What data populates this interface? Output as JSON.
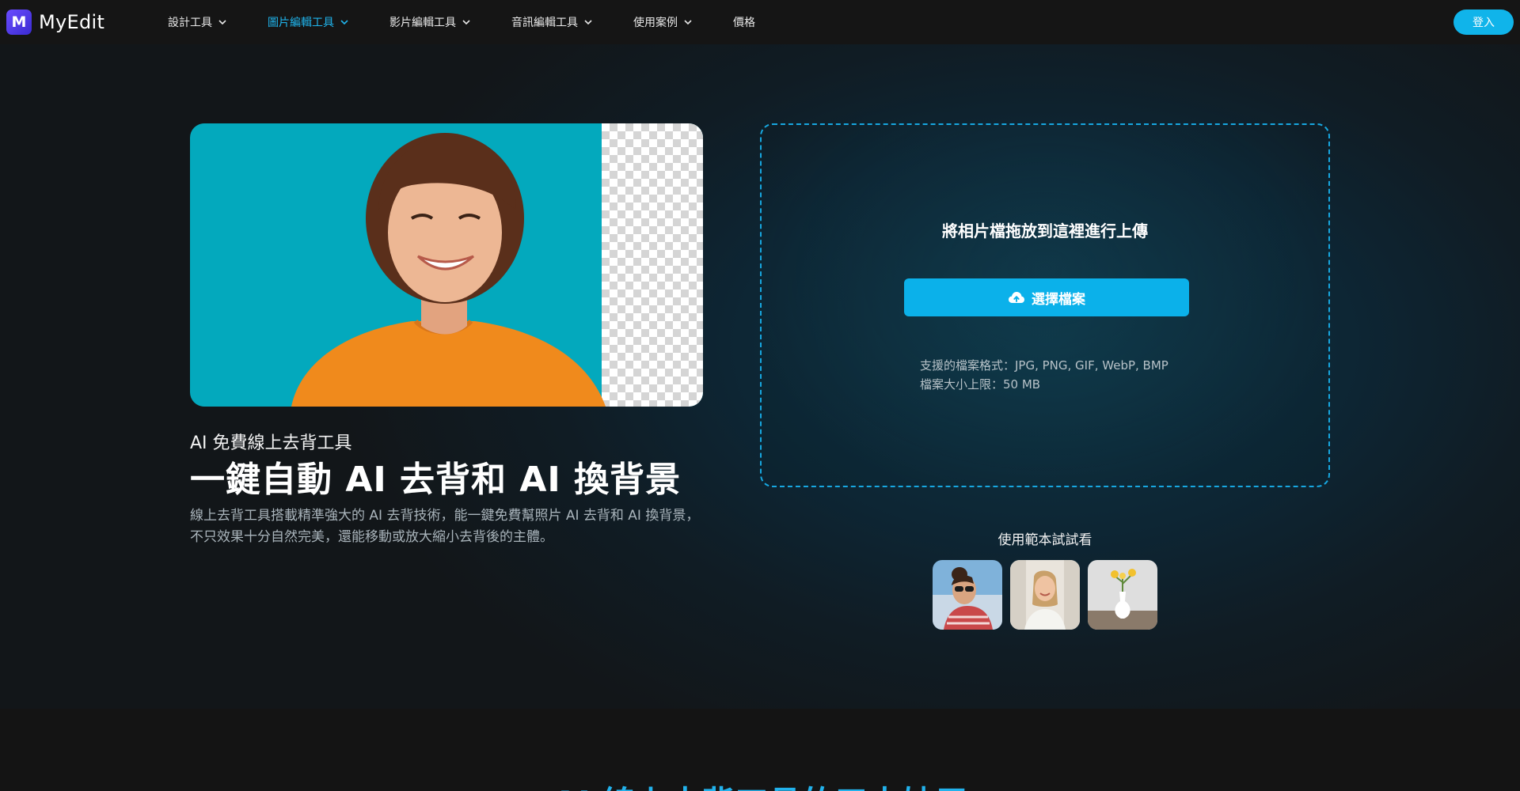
{
  "brand": {
    "logo_letter": "M",
    "name": "MyEdit"
  },
  "nav": {
    "items": [
      {
        "label": "設計工具",
        "has_dropdown": true,
        "active": false
      },
      {
        "label": "圖片編輯工具",
        "has_dropdown": true,
        "active": true
      },
      {
        "label": "影片編輯工具",
        "has_dropdown": true,
        "active": false
      },
      {
        "label": "音訊編輯工具",
        "has_dropdown": true,
        "active": false
      },
      {
        "label": "使用案例",
        "has_dropdown": true,
        "active": false
      },
      {
        "label": "價格",
        "has_dropdown": false,
        "active": false
      }
    ],
    "login_label": "登入"
  },
  "hero": {
    "subtitle": "AI 免費線上去背工具",
    "title": "一鍵自動 AI 去背和 AI 換背景",
    "description": "線上去背工具搭載精準強大的 AI 去背技術，能一鍵免費幫照片 AI 去背和 AI 換背景，不只效果十分自然完美，還能移動或放大縮小去背後的主體。"
  },
  "upload": {
    "drop_text": "將相片檔拖放到這裡進行上傳",
    "choose_label": "選擇檔案",
    "formats_text": "支援的檔案格式：JPG, PNG, GIF, WebP, BMP",
    "size_text": "檔案大小上限：50 MB"
  },
  "samples": {
    "label": "使用範本試試看"
  },
  "bottom": {
    "heading": "AI 線上去背工具的三大妙用"
  },
  "colors": {
    "accent": "#10b4ea",
    "nav_active": "#20b4ec",
    "hero_bg_teal": "#03a9bd",
    "shirt_orange": "#f08a1c"
  },
  "icons": {
    "upload": "cloud-upload-icon",
    "dropdown": "chevron-down-icon"
  }
}
